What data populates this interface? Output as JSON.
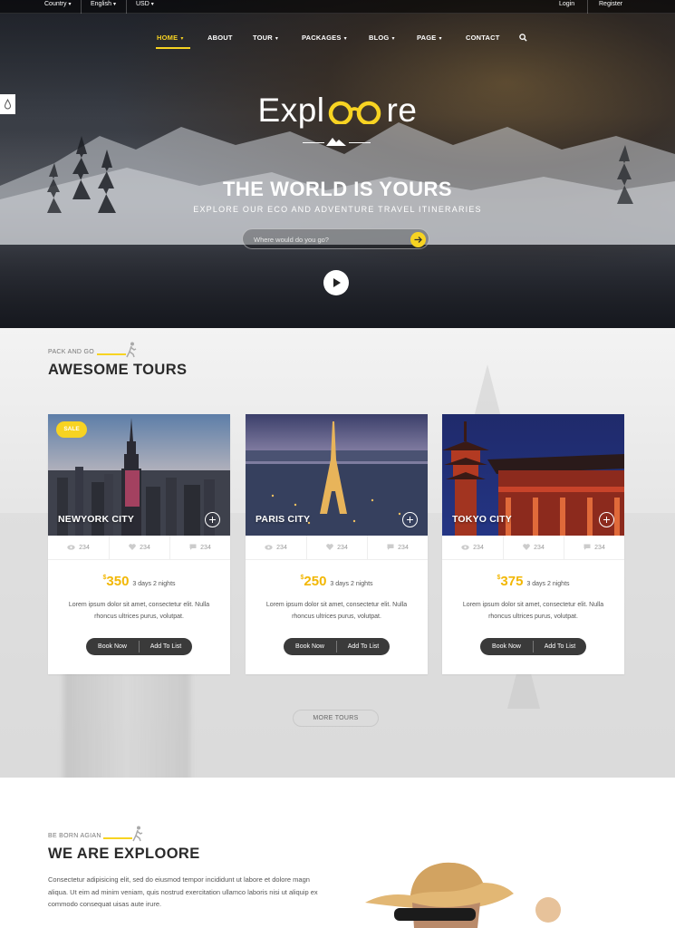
{
  "topbar": {
    "country": "Country",
    "language": "English",
    "currency": "USD",
    "login": "Login",
    "register": "Register"
  },
  "nav": {
    "home": "HOME",
    "about": "ABOUT",
    "tour": "TOUR",
    "packages": "PACKAGES",
    "blog": "BLOG",
    "page": "PAGE",
    "contact": "CONTACT"
  },
  "hero": {
    "logo_left": "Expl",
    "logo_right": "re",
    "title": "THE WORLD IS YOURS",
    "subtitle": "EXPLORE OUR ECO AND ADVENTURE TRAVEL ITINERARIES",
    "search_placeholder": "Where would do you go?"
  },
  "tours": {
    "eyebrow": "PACK AND GO",
    "title": "AWESOME TOURS",
    "more_label": "MORE TOURS",
    "cards": [
      {
        "city": "NEWYORK CITY",
        "sale": "SALE",
        "views": "234",
        "likes": "234",
        "comments": "234",
        "currency": "$",
        "price": "350",
        "duration": "3 days 2 nights",
        "description": "Lorem ipsum dolor sit amet, consectetur elit. Nulla rhoncus ultrices purus, volutpat.",
        "book": "Book Now",
        "add": "Add To List"
      },
      {
        "city": "PARIS CITY",
        "views": "234",
        "likes": "234",
        "comments": "234",
        "currency": "$",
        "price": "250",
        "duration": "3 days 2 nights",
        "description": "Lorem ipsum dolor sit amet, consectetur elit. Nulla rhoncus ultrices purus, volutpat.",
        "book": "Book Now",
        "add": "Add To List"
      },
      {
        "city": "TOKYO CITY",
        "views": "234",
        "likes": "234",
        "comments": "234",
        "currency": "$",
        "price": "375",
        "duration": "3 days 2 nights",
        "description": "Lorem ipsum dolor sit amet, consectetur elit. Nulla rhoncus ultrices purus, volutpat.",
        "book": "Book Now",
        "add": "Add To List"
      }
    ]
  },
  "about": {
    "eyebrow": "BE BORN AGIAN",
    "title": "WE ARE EXPLOORE",
    "paragraph": "Consectetur adipisicing elit, sed do eiusmod tempor incididunt ut labore et dolore magn aliqua. Ut eim ad minim veniam, quis nostrud exercitation ullamco laboris nisi ut aliquip ex commodo consequat uisas aute irure."
  },
  "icons": {
    "caret": "chevron-down-icon",
    "search": "search-icon",
    "views": "eye-icon",
    "likes": "heart-icon",
    "comments": "comment-icon",
    "play": "play-icon",
    "arrow": "arrow-right-icon",
    "hiker": "hiker-icon",
    "side": "drop-icon"
  },
  "colors": {
    "accent": "#f7d322",
    "price": "#f2b705",
    "button": "#3a3a3a"
  }
}
